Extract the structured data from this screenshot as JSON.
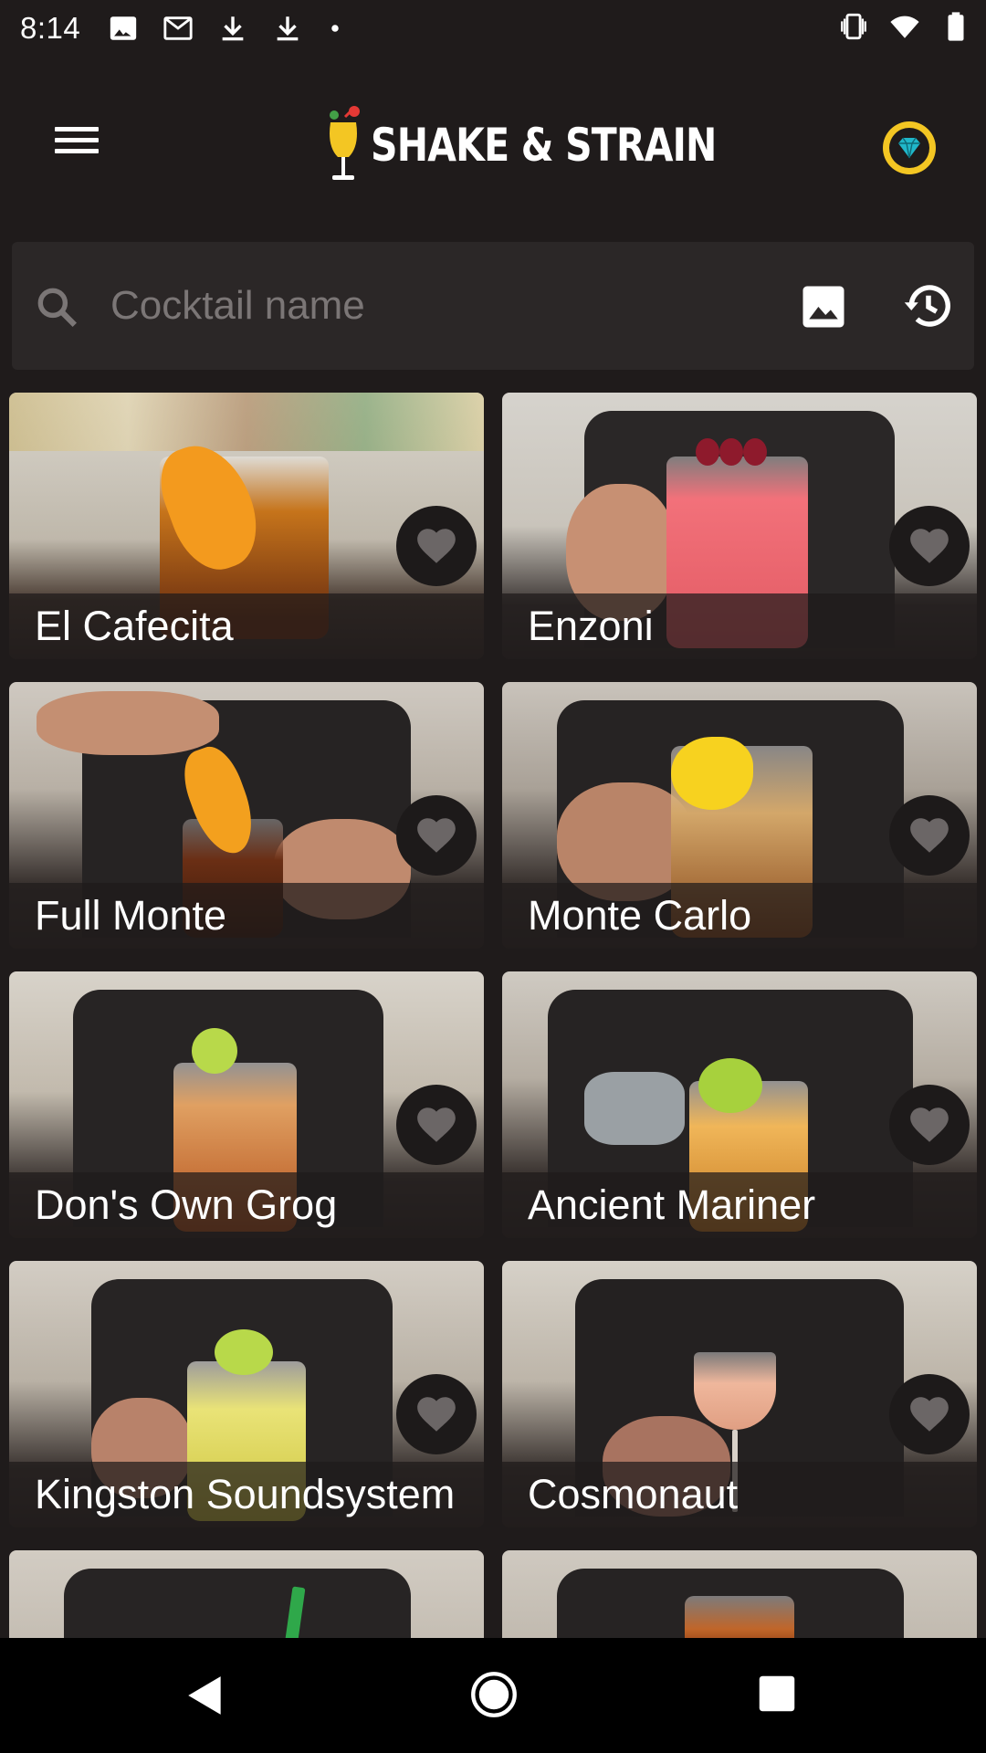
{
  "status_bar": {
    "time": "8:14",
    "left_icons": [
      "image-icon",
      "gmail-icon",
      "download-icon",
      "download-icon",
      "dot-icon"
    ],
    "right_icons": [
      "vibrate-icon",
      "wifi-icon",
      "battery-icon"
    ]
  },
  "app": {
    "title": "SHAKE & STRAIN",
    "menu_icon": "hamburger-menu-icon",
    "premium_icon": "diamond-badge-icon"
  },
  "search": {
    "placeholder": "Cocktail name",
    "value": "",
    "search_icon": "search-icon",
    "image_search_icon": "image-icon",
    "history_icon": "history-icon"
  },
  "cocktails": [
    {
      "name": "El Cafecita",
      "favorite": false
    },
    {
      "name": "Enzoni",
      "favorite": false
    },
    {
      "name": "Full Monte",
      "favorite": false
    },
    {
      "name": "Monte Carlo",
      "favorite": false
    },
    {
      "name": "Don's Own Grog",
      "favorite": false
    },
    {
      "name": "Ancient Mariner",
      "favorite": false
    },
    {
      "name": "Kingston Soundsystem",
      "favorite": false
    },
    {
      "name": "Cosmonaut",
      "favorite": false
    }
  ],
  "nav_bar": {
    "back_icon": "back-triangle-icon",
    "home_icon": "home-circle-icon",
    "recents_icon": "recents-square-icon"
  },
  "colors": {
    "background": "#1f1b1b",
    "search_background": "#2b2727",
    "favorite_button": "#1d1a1a",
    "heart": "#6b6666",
    "accent_gold": "#f3c623",
    "diamond": "#20b7c9"
  }
}
